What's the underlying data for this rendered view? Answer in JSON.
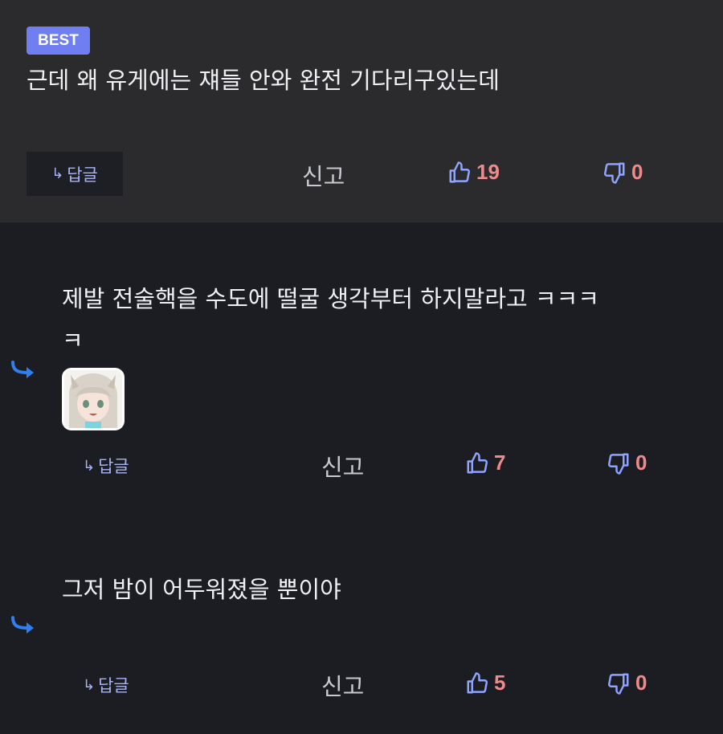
{
  "best": {
    "badge": "BEST",
    "text": "근데 왜 유게에는 쟤들 안와 완전 기다리구있는데",
    "reply_label": "답글",
    "report_label": "신고",
    "likes": "19",
    "dislikes": "0"
  },
  "replies": [
    {
      "text_line1": "제발 전술핵을 수도에 떨굴 생각부터 하지말라고 ㅋㅋㅋ",
      "text_line2": "ㅋ",
      "reply_label": "답글",
      "report_label": "신고",
      "likes": "7",
      "dislikes": "0"
    },
    {
      "text_line1": "그저 밤이 어두워졌을 뿐이야",
      "reply_label": "답글",
      "report_label": "신고",
      "likes": "5",
      "dislikes": "0"
    }
  ],
  "colors": {
    "badge": "#6f7ff2",
    "count": "#ee8a8c",
    "icon": "#8fa4ff",
    "reply_arrow": "#2f7ff0"
  }
}
